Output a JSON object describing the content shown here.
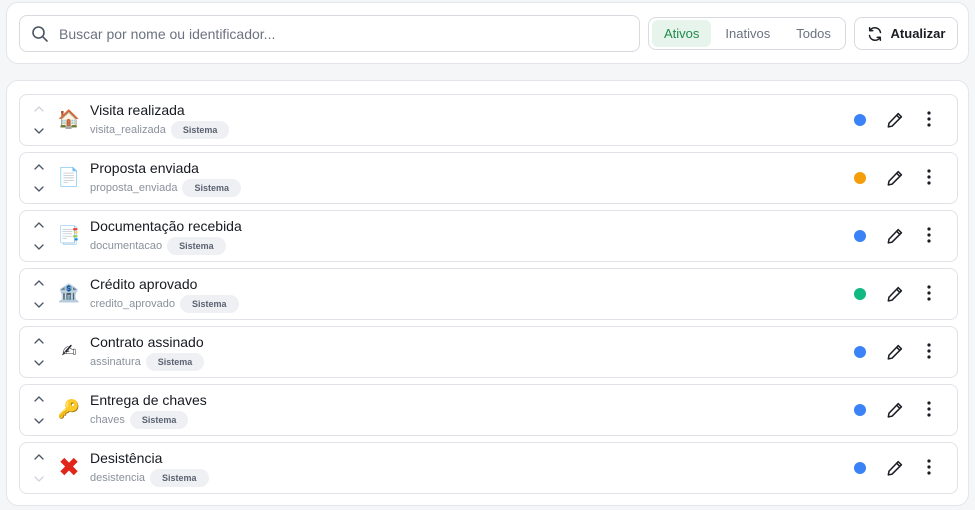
{
  "search": {
    "placeholder": "Buscar por nome ou identificador...",
    "value": ""
  },
  "filters": [
    {
      "label": "Ativos",
      "active": true
    },
    {
      "label": "Inativos",
      "active": false
    },
    {
      "label": "Todos",
      "active": false
    }
  ],
  "refresh": {
    "label": "Atualizar"
  },
  "badge_label": "Sistema",
  "colors": {
    "blue": "#3b82f6",
    "orange": "#f59e0b",
    "green": "#10b981",
    "accent": "#1f8a4c"
  },
  "items": [
    {
      "title": "Visita realizada",
      "ident": "visita_realizada",
      "badge": "Sistema",
      "emoji": "🏠",
      "icon": "house-emoji-icon",
      "color": "#3b82f6"
    },
    {
      "title": "Proposta enviada",
      "ident": "proposta_enviada",
      "badge": "Sistema",
      "emoji": "📄",
      "icon": "page-document-icon",
      "color": "#f59e0b"
    },
    {
      "title": "Documentação recebida",
      "ident": "documentacao",
      "badge": "Sistema",
      "emoji": "📑",
      "icon": "documents-icon",
      "color": "#3b82f6"
    },
    {
      "title": "Crédito aprovado",
      "ident": "credito_aprovado",
      "badge": "Sistema",
      "emoji": "🏦",
      "icon": "bank-icon",
      "color": "#10b981"
    },
    {
      "title": "Contrato assinado",
      "ident": "assinatura",
      "badge": "Sistema",
      "emoji": "✍",
      "icon": "writing-hand-icon",
      "color": "#3b82f6"
    },
    {
      "title": "Entrega de chaves",
      "ident": "chaves",
      "badge": "Sistema",
      "emoji": "🔑",
      "icon": "key-icon",
      "color": "#3b82f6"
    },
    {
      "title": "Desistência",
      "ident": "desistencia",
      "badge": "Sistema",
      "emoji": "✖",
      "icon": "cross-mark-icon",
      "color": "#3b82f6"
    }
  ]
}
